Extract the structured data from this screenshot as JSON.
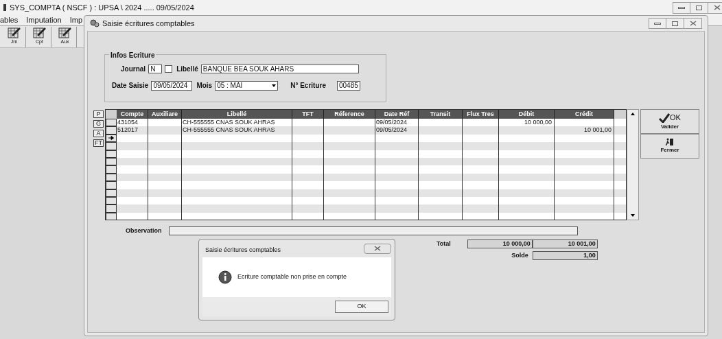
{
  "window": {
    "title": "SYS_COMPTA ( NSCF ) :  UPSA \\ 2024 ..... 09/05/2024"
  },
  "menu": [
    "ables",
    "Imputation",
    "Imp"
  ],
  "toolbar": [
    {
      "label": "Jrn"
    },
    {
      "label": "Cpt"
    },
    {
      "label": "Aux"
    }
  ],
  "child_window": {
    "title": "Saisie écritures comptables",
    "infos": {
      "legend": "Infos Ecriture",
      "journal_label": "Journal",
      "journal": "N",
      "journal_checked": false,
      "libelle_label": "Libellé",
      "libelle": "BANQUE BEA SOUK AHARS",
      "date_label": "Date Saisie",
      "date": "09/05/2024",
      "mois_label": "Mois",
      "mois": "05 : MAI",
      "numero_label": "N° Ecriture",
      "numero": "00485"
    },
    "side_buttons": [
      "P",
      "G",
      "A",
      "FT"
    ],
    "table": {
      "columns": [
        "Compte",
        "Auxiliare",
        "Libellé",
        "TFT",
        "Réference",
        "Date Réf",
        "Transit",
        "Flux Tres",
        "Débit",
        "Crédit"
      ],
      "rows": [
        {
          "cells": [
            "431054",
            "",
            "CH-555555 CNAS SOUK AHRAS",
            "",
            "",
            "09/05/2024",
            "",
            "",
            "10 000,00",
            ""
          ]
        },
        {
          "cells": [
            "512017",
            "",
            "CH-555555 CNAS SOUK AHRAS",
            "",
            "",
            "09/05/2024",
            "",
            "",
            "",
            "10 001,00"
          ]
        }
      ]
    },
    "buttons": [
      {
        "kind": "ok",
        "label": "OK",
        "caption": "Valider"
      },
      {
        "kind": "close",
        "caption": "Fermer"
      }
    ],
    "observation_label": "Observation",
    "total_label": "Total",
    "total_debit": "10 000,00",
    "total_credit": "10 001,00",
    "solde_label": "Solde",
    "solde": "1,00"
  },
  "dialog": {
    "title": "Saisie écritures comptables",
    "message": "Ecriture comptable non prise en compte",
    "button": "OK"
  }
}
